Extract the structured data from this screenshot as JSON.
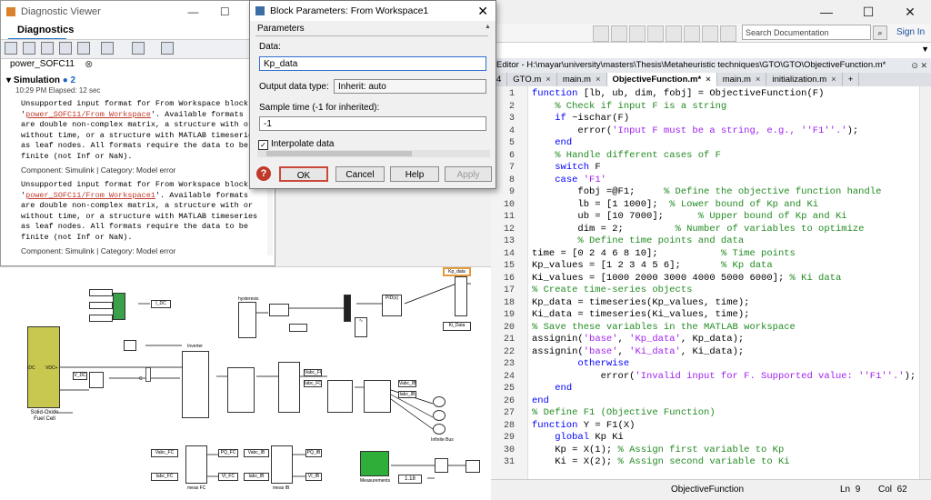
{
  "diagnostic_viewer": {
    "title": "Diagnostic Viewer",
    "menu_label": "Diagnostics",
    "model_tab": "power_SOFC11",
    "simulation_label": "Simulation",
    "simulation_count": "2",
    "time_text": "10:29 PM   Elapsed: 12 sec",
    "messages": [
      {
        "pre": "Unsupported input format for From Workspace block '",
        "link": "power_SOFC11/From Workspace",
        "post": "'. Available formats are double non-complex matrix, a structure with or without time, or a structure with MATLAB timeseries as leaf nodes. All formats require the data to be finite (not Inf or NaN).",
        "component": "Component:  Simulink | Category:  Model error"
      },
      {
        "pre": "Unsupported input format for From Workspace block '",
        "link": "power_SOFC11/From Workspace1",
        "post": "'. Available formats are double non-complex matrix, a structure with or without time, or a structure with MATLAB timeseries as leaf nodes. All formats require the data to be finite (not Inf or NaN).",
        "component": "Component:  Simulink | Category:  Model error"
      }
    ]
  },
  "dialog": {
    "title": "Block Parameters: From Workspace1",
    "section": "Parameters",
    "data_label": "Data:",
    "data_value": "Kp_data",
    "output_type_label": "Output data type:",
    "output_type_value": "Inherit: auto",
    "sample_time_label": "Sample time (-1 for inherited):",
    "sample_time_value": "-1",
    "interpolate_label": "Interpolate data",
    "interpolate_checked": true,
    "buttons": {
      "ok": "OK",
      "cancel": "Cancel",
      "help": "Help",
      "apply": "Apply"
    }
  },
  "matlab": {
    "search_placeholder": "Search Documentation",
    "sign_in": "Sign In",
    "editor_title": "Editor - H:\\mayar\\university\\masters\\Thesis\\Metaheuristic techniques\\GTO\\GTO\\ObjectiveFunction.m*",
    "tabs": [
      "GTO.m",
      "main.m",
      "ObjectiveFunction.m*",
      "main.m",
      "initialization.m"
    ],
    "active_tab": 2,
    "tab_number": "4",
    "code_lines": [
      {
        "n": "1",
        "segs": [
          {
            "c": "kw",
            "t": "function"
          },
          {
            "c": "",
            "t": " [lb, ub, dim, fobj] = ObjectiveFunction(F)"
          }
        ]
      },
      {
        "n": "2",
        "segs": [
          {
            "c": "cm",
            "t": "    % Check if input F is a string"
          }
        ]
      },
      {
        "n": "3",
        "segs": [
          {
            "c": "",
            "t": "    "
          },
          {
            "c": "kw",
            "t": "if"
          },
          {
            "c": "",
            "t": " ~ischar(F)"
          }
        ]
      },
      {
        "n": "4",
        "segs": [
          {
            "c": "",
            "t": "        error("
          },
          {
            "c": "st",
            "t": "'Input F must be a string, e.g., ''F1''.'"
          },
          {
            "c": "",
            "t": ");"
          }
        ]
      },
      {
        "n": "5",
        "segs": [
          {
            "c": "",
            "t": "    "
          },
          {
            "c": "kw",
            "t": "end"
          }
        ]
      },
      {
        "n": "6",
        "segs": [
          {
            "c": "cm",
            "t": "    % Handle different cases of F"
          }
        ]
      },
      {
        "n": "7",
        "segs": [
          {
            "c": "",
            "t": "    "
          },
          {
            "c": "kw",
            "t": "switch"
          },
          {
            "c": "",
            "t": " F"
          }
        ]
      },
      {
        "n": "8",
        "segs": [
          {
            "c": "",
            "t": "    "
          },
          {
            "c": "kw",
            "t": "case"
          },
          {
            "c": "",
            "t": " "
          },
          {
            "c": "st",
            "t": "'F1'"
          }
        ]
      },
      {
        "n": "9",
        "segs": [
          {
            "c": "",
            "t": "        fobj =@F1;     "
          },
          {
            "c": "cm",
            "t": "% Define the objective function handle"
          }
        ]
      },
      {
        "n": "10",
        "segs": [
          {
            "c": "",
            "t": "        lb = [1 1000];  "
          },
          {
            "c": "cm",
            "t": "% Lower bound of Kp and Ki"
          }
        ]
      },
      {
        "n": "11",
        "segs": [
          {
            "c": "",
            "t": "        ub = [10 7000];      "
          },
          {
            "c": "cm",
            "t": "% Upper bound of Kp and Ki"
          }
        ]
      },
      {
        "n": "12",
        "segs": [
          {
            "c": "",
            "t": "        dim = 2;         "
          },
          {
            "c": "cm",
            "t": "% Number of variables to optimize"
          }
        ]
      },
      {
        "n": "13",
        "segs": [
          {
            "c": "cm",
            "t": "        % Define time points and data"
          }
        ]
      },
      {
        "n": "14",
        "segs": [
          {
            "c": "",
            "t": "time = [0 2 4 6 8 10];           "
          },
          {
            "c": "cm",
            "t": "% Time points"
          }
        ]
      },
      {
        "n": "15",
        "segs": [
          {
            "c": "",
            "t": "Kp_values = [1 2 3 4 5 6];       "
          },
          {
            "c": "cm",
            "t": "% Kp data"
          }
        ]
      },
      {
        "n": "16",
        "segs": [
          {
            "c": "",
            "t": "Ki_values = [1000 2000 3000 4000 5000 6000]; "
          },
          {
            "c": "cm",
            "t": "% Ki data"
          }
        ]
      },
      {
        "n": "17",
        "segs": [
          {
            "c": "cm",
            "t": "% Create time-series objects"
          }
        ]
      },
      {
        "n": "18",
        "segs": [
          {
            "c": "",
            "t": "Kp_data = timeseries(Kp_values, time);"
          }
        ]
      },
      {
        "n": "19",
        "segs": [
          {
            "c": "",
            "t": "Ki_data = timeseries(Ki_values, time);"
          }
        ]
      },
      {
        "n": "20",
        "segs": [
          {
            "c": "cm",
            "t": "% Save these variables in the MATLAB workspace"
          }
        ]
      },
      {
        "n": "21",
        "segs": [
          {
            "c": "",
            "t": "assignin("
          },
          {
            "c": "st",
            "t": "'base'"
          },
          {
            "c": "",
            "t": ", "
          },
          {
            "c": "st",
            "t": "'Kp_data'"
          },
          {
            "c": "",
            "t": ", Kp_data);"
          }
        ]
      },
      {
        "n": "22",
        "segs": [
          {
            "c": "",
            "t": "assignin("
          },
          {
            "c": "st",
            "t": "'base'"
          },
          {
            "c": "",
            "t": ", "
          },
          {
            "c": "st",
            "t": "'Ki_data'"
          },
          {
            "c": "",
            "t": ", Ki_data);"
          }
        ]
      },
      {
        "n": "23",
        "segs": [
          {
            "c": "",
            "t": "        "
          },
          {
            "c": "kw",
            "t": "otherwise"
          }
        ]
      },
      {
        "n": "24",
        "segs": [
          {
            "c": "",
            "t": "            error("
          },
          {
            "c": "st",
            "t": "'Invalid input for F. Supported value: ''F1''.'"
          },
          {
            "c": "",
            "t": ");"
          }
        ]
      },
      {
        "n": "25",
        "segs": [
          {
            "c": "",
            "t": "    "
          },
          {
            "c": "kw",
            "t": "end"
          }
        ]
      },
      {
        "n": "26",
        "segs": [
          {
            "c": "kw",
            "t": "end"
          }
        ]
      },
      {
        "n": "27",
        "segs": [
          {
            "c": "cm",
            "t": "% Define F1 (Objective Function)"
          }
        ]
      },
      {
        "n": "28",
        "segs": [
          {
            "c": "kw",
            "t": "function"
          },
          {
            "c": "",
            "t": " Y = F1(X)"
          }
        ]
      },
      {
        "n": "29",
        "segs": [
          {
            "c": "",
            "t": "    "
          },
          {
            "c": "kw",
            "t": "global"
          },
          {
            "c": "",
            "t": " Kp Ki"
          }
        ]
      },
      {
        "n": "30",
        "segs": [
          {
            "c": "",
            "t": "    Kp = X(1); "
          },
          {
            "c": "cm",
            "t": "% Assign first variable to Kp"
          }
        ]
      },
      {
        "n": "31",
        "segs": [
          {
            "c": "",
            "t": "    Ki = X(2); "
          },
          {
            "c": "cm",
            "t": "% Assign second variable to Ki"
          }
        ]
      }
    ],
    "status": {
      "function": "ObjectiveFunction",
      "ln_label": "Ln",
      "ln": "9",
      "col_label": "Col",
      "col": "62"
    }
  },
  "model": {
    "labels": {
      "sofc": "Solid-Oxide Fuel Cell",
      "inverter": "Inverter",
      "hysteresis": "hysteresis",
      "kp_block": "Kp_data",
      "ki_block": "Ki_Data",
      "from_ws": "From Workspace1",
      "pid": "PID(s)",
      "infinite_bus": "Infinite Bus",
      "measurements": "Measurements",
      "meas_fc": "meas FC",
      "meas_ib": "meas IB",
      "display_value": "1.18",
      "i_dc": "I_DC",
      "v_dc": "V_DC",
      "vabc_fc": "Vabc_FC",
      "iabc_fc": "Iabc_FC",
      "vabc_ib": "Vabc_IB",
      "iabc_ib": "Iabc_IB",
      "pq_fc": "PQ_FC",
      "vi_fc": "VI_FC",
      "pq_ib": "PQ_IB",
      "vi_ib": "VI_IB",
      "c": "C"
    }
  }
}
